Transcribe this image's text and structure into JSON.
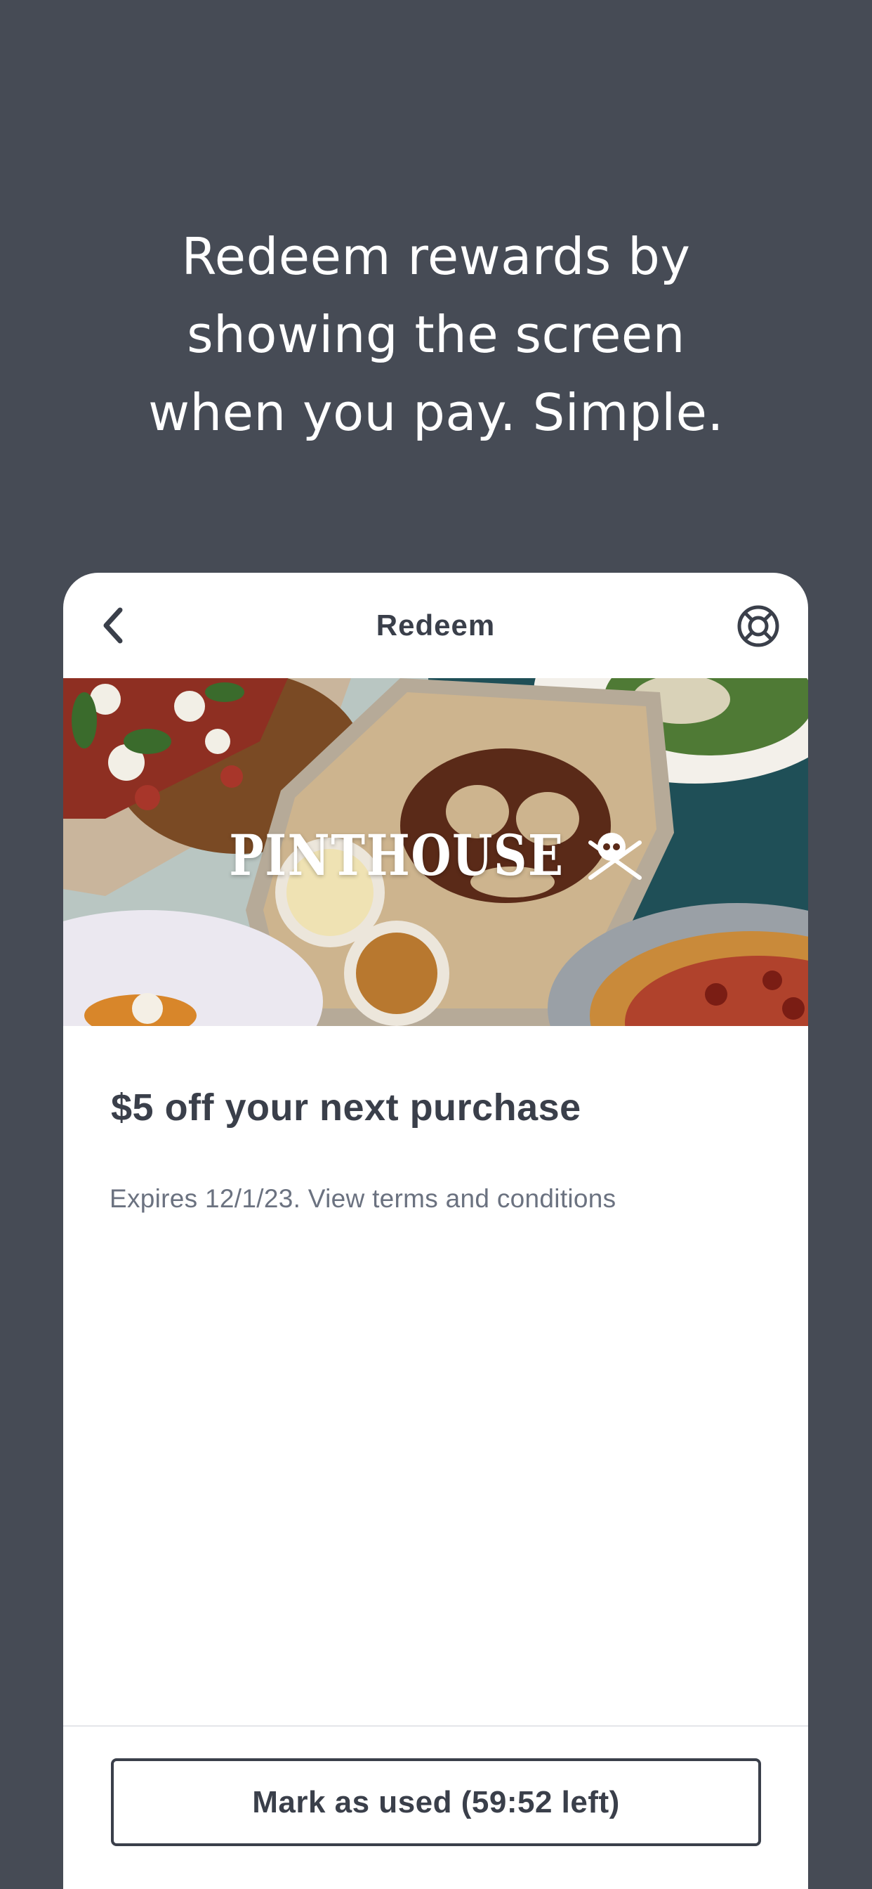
{
  "headline": {
    "line1": "Redeem rewards by",
    "line2": "showing the screen",
    "line3": "when you pay. Simple."
  },
  "card": {
    "title": "Redeem",
    "back_icon": "chevron-left-icon",
    "help_icon": "lifebuoy-icon"
  },
  "hero": {
    "brand": "PINTHOUSE"
  },
  "offer": {
    "title": "$5 off your next purchase",
    "expiry": "Expires 12/1/23. View terms and conditions"
  },
  "footer": {
    "button_label": "Mark as used (59:52 left)"
  },
  "colors": {
    "background": "#464b55",
    "card": "#ffffff",
    "text_dark": "#3a3f4a",
    "text_muted": "#6b7280"
  }
}
